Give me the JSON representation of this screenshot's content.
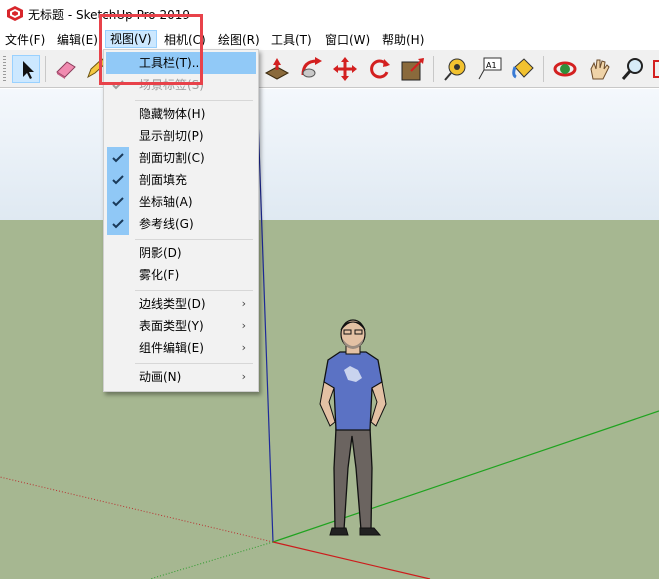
{
  "window": {
    "title": "无标题 - SketchUp Pro 2019",
    "logo_icon": "sketchup-logo-icon"
  },
  "menubar": {
    "items": [
      {
        "label": "文件(F)"
      },
      {
        "label": "编辑(E)"
      },
      {
        "label": "视图(V)",
        "active": true
      },
      {
        "label": "相机(C)"
      },
      {
        "label": "绘图(R)"
      },
      {
        "label": "工具(T)"
      },
      {
        "label": "窗口(W)"
      },
      {
        "label": "帮助(H)"
      }
    ]
  },
  "toolbar": {
    "tools": [
      "select-arrow-icon",
      "eraser-icon",
      "pencil-icon",
      "push-pull-icon",
      "follow-me-icon",
      "move-icon",
      "rotate-icon",
      "scale-icon",
      "tape-measure-icon",
      "text-label-icon",
      "paint-bucket-icon",
      "orbit-icon",
      "pan-icon",
      "zoom-icon",
      "zoom-extents-icon"
    ],
    "text_tool_label": "A1"
  },
  "view_menu": {
    "items": [
      {
        "label": "工具栏(T)...",
        "state": "hover"
      },
      {
        "label": "场景标签(S)",
        "state": "disabled",
        "checked": true
      },
      {
        "label": "隐藏物体(H)"
      },
      {
        "label": "显示剖切(P)"
      },
      {
        "label": "剖面切割(C)",
        "checked": true
      },
      {
        "label": "剖面填充",
        "checked": true
      },
      {
        "label": "坐标轴(A)",
        "checked": true
      },
      {
        "label": "参考线(G)",
        "checked": true
      },
      {
        "label": "阴影(D)"
      },
      {
        "label": "雾化(F)"
      },
      {
        "label": "边线类型(D)",
        "submenu": true
      },
      {
        "label": "表面类型(Y)",
        "submenu": true
      },
      {
        "label": "组件编辑(E)",
        "submenu": true
      },
      {
        "label": "动画(N)",
        "submenu": true
      }
    ],
    "submenu_arrow": "›"
  },
  "colors": {
    "sky": "#e8f0f7",
    "ground": "#a6b791",
    "menu_hover": "#91c9f7",
    "check_bg": "#90c8f6",
    "highlight": "#e8424a",
    "axis_red": "#cc0000",
    "axis_green": "#00aa00",
    "axis_blue": "#0000cc"
  }
}
